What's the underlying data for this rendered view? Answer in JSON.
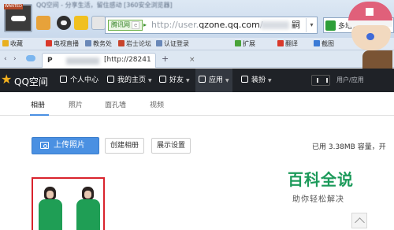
{
  "browser": {
    "title_text": "QQ空间 - 分享生活，留住感动 [360安全浏览器]",
    "address": {
      "engine_badge": "腾讯网",
      "engine_badge_extra": "e",
      "url_prefix": "http://user.",
      "url_host": "qzone.qq.com",
      "url_after": "/",
      "url_suffix": "嗣"
    },
    "search_placeholder": "多地公",
    "bookmarks": [
      {
        "label": "收藏",
        "icon": "star-icon",
        "color": "#e8b020"
      },
      {
        "label": "电视直播",
        "icon": "tv-icon",
        "color": "#d9392b"
      },
      {
        "label": "教务处",
        "icon": "doc-icon",
        "color": "#6a88b8"
      },
      {
        "label": "岩士论坛",
        "icon": "forum-icon",
        "color": "#c8442c"
      },
      {
        "label": "认证登录",
        "icon": "doc-icon",
        "color": "#6a88b8"
      },
      {
        "label": "扩展",
        "icon": "puzzle-icon",
        "color": "#4aa43a"
      },
      {
        "label": "翻译",
        "icon": "translate-icon",
        "color": "#d9392b"
      },
      {
        "label": "截图",
        "icon": "scissors-icon",
        "color": "#3b7bd6"
      }
    ],
    "tabs": {
      "nav_back": "‹",
      "nav_forward": "›",
      "active_logo": "P",
      "active_title": "[http://28241",
      "close": "×",
      "new_tab": "+"
    }
  },
  "qzone": {
    "brand": "QQ空间",
    "nav": [
      {
        "label": "个人中心",
        "icon": "person-icon",
        "caret": false
      },
      {
        "label": "我的主页",
        "icon": "home-icon",
        "caret": true
      },
      {
        "label": "好友",
        "icon": "friends-icon",
        "caret": true
      },
      {
        "label": "应用",
        "icon": "apps-icon",
        "caret": true
      },
      {
        "label": "装扮",
        "icon": "shirt-icon",
        "caret": true
      }
    ],
    "user_label": "用户/应用",
    "subnav": [
      {
        "label": "相册",
        "active": true
      },
      {
        "label": "照片",
        "active": false
      },
      {
        "label": "面孔墙",
        "active": false
      },
      {
        "label": "视频",
        "active": false
      }
    ],
    "upload_button": "上传照片",
    "create_album_button": "创建相册",
    "display_settings_button": "展示设置",
    "storage_text": "已用 3.38MB 容量，开",
    "accent_color": "#4a90e2"
  },
  "watermark": {
    "main": "百科全说",
    "sub": "助你轻松解决",
    "color": "#1c9a5a"
  }
}
